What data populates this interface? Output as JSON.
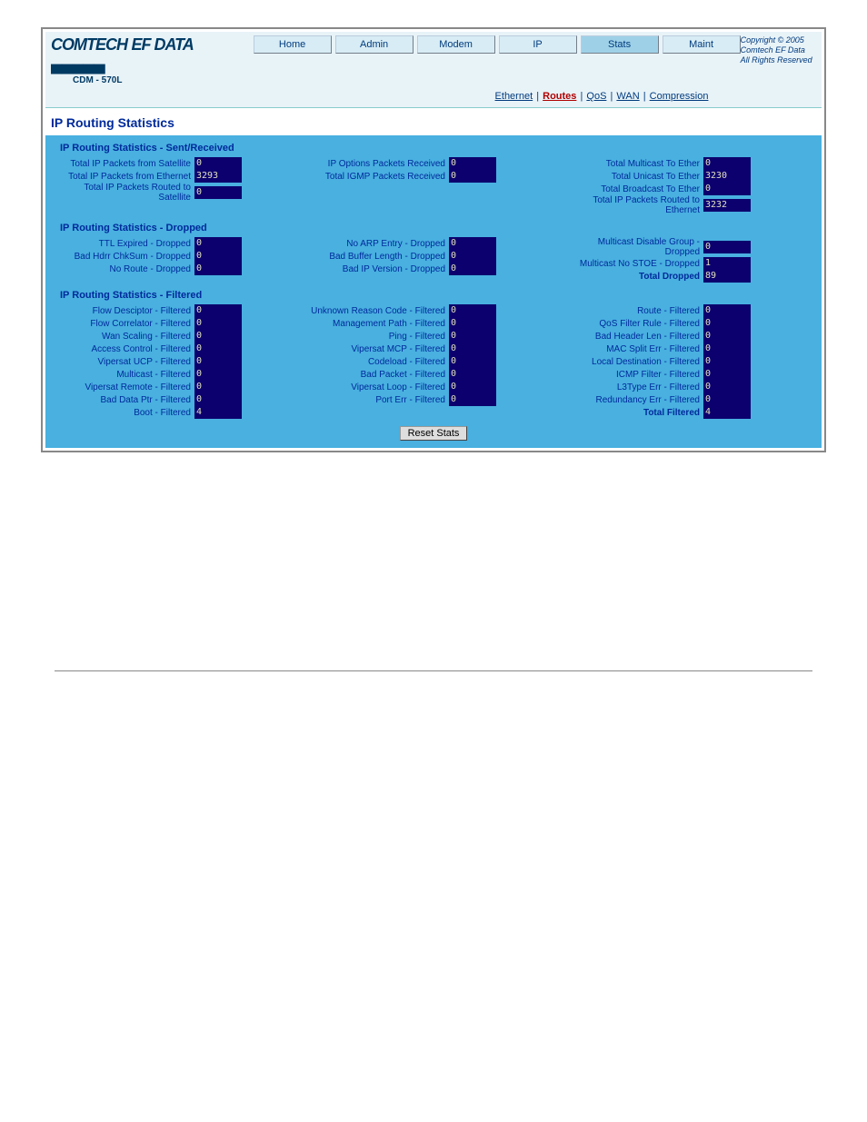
{
  "copyright": {
    "line1": "Copyright © 2005",
    "line2": "Comtech EF Data",
    "line3": "All Rights Reserved"
  },
  "logo": {
    "main": "COMTECH",
    "sub": "EF DATA ▄▄▄▄▄"
  },
  "model": "CDM - 570L",
  "tabs": [
    "Home",
    "Admin",
    "Modem",
    "IP",
    "Stats",
    "Maint"
  ],
  "active_tab": "Stats",
  "subnav": [
    "Ethernet",
    "Routes",
    "QoS",
    "WAN",
    "Compression"
  ],
  "subnav_current": "Routes",
  "page_title": "IP Routing Statistics",
  "sections": {
    "sent_received": {
      "heading": "IP Routing Statistics - Sent/Received",
      "col1": [
        {
          "label": "Total IP Packets from Satellite",
          "value": "0"
        },
        {
          "label": "Total IP Packets from Ethernet",
          "value": "3293"
        },
        {
          "label": "Total IP Packets Routed to Satellite",
          "value": "0"
        }
      ],
      "col2": [
        {
          "label": "IP Options Packets Received",
          "value": "0"
        },
        {
          "label": "Total IGMP Packets Received",
          "value": "0"
        }
      ],
      "col3": [
        {
          "label": "Total Multicast To Ether",
          "value": "0"
        },
        {
          "label": "Total Unicast To Ether",
          "value": "3230"
        },
        {
          "label": "Total Broadcast To Ether",
          "value": "0"
        },
        {
          "label": "Total IP Packets Routed to Ethernet",
          "value": "3232"
        }
      ]
    },
    "dropped": {
      "heading": "IP Routing Statistics - Dropped",
      "col1": [
        {
          "label": "TTL Expired - Dropped",
          "value": "0"
        },
        {
          "label": "Bad Hdrr ChkSum - Dropped",
          "value": "0"
        },
        {
          "label": "No Route - Dropped",
          "value": "0"
        }
      ],
      "col2": [
        {
          "label": "No ARP Entry - Dropped",
          "value": "0"
        },
        {
          "label": "Bad Buffer Length - Dropped",
          "value": "0"
        },
        {
          "label": "Bad IP Version - Dropped",
          "value": "0"
        }
      ],
      "col3": [
        {
          "label": "Multicast Disable Group - Dropped",
          "value": "0"
        },
        {
          "label": "Multicast No STOE - Dropped",
          "value": "1"
        },
        {
          "label": "Total Dropped",
          "value": "89",
          "bold": true
        }
      ]
    },
    "filtered": {
      "heading": "IP Routing Statistics - Filtered",
      "col1": [
        {
          "label": "Flow Desciptor - Filtered",
          "value": "0"
        },
        {
          "label": "Flow Correlator - Filtered",
          "value": "0"
        },
        {
          "label": "Wan Scaling - Filtered",
          "value": "0"
        },
        {
          "label": "Access Control - Filtered",
          "value": "0"
        },
        {
          "label": "Vipersat UCP - Filtered",
          "value": "0"
        },
        {
          "label": "Multicast - Filtered",
          "value": "0"
        },
        {
          "label": "Vipersat Remote - Filtered",
          "value": "0"
        },
        {
          "label": "Bad Data Ptr - Filtered",
          "value": "0"
        },
        {
          "label": "Boot - Filtered",
          "value": "4"
        }
      ],
      "col2": [
        {
          "label": "Unknown Reason Code - Filtered",
          "value": "0"
        },
        {
          "label": "Management Path - Filtered",
          "value": "0"
        },
        {
          "label": "Ping - Filtered",
          "value": "0"
        },
        {
          "label": "Vipersat MCP - Filtered",
          "value": "0"
        },
        {
          "label": "Codeload - Filtered",
          "value": "0"
        },
        {
          "label": "Bad Packet - Filtered",
          "value": "0"
        },
        {
          "label": "Vipersat Loop - Filtered",
          "value": "0"
        },
        {
          "label": "Port Err - Filtered",
          "value": "0"
        }
      ],
      "col3": [
        {
          "label": "Route - Filtered",
          "value": "0"
        },
        {
          "label": "QoS Filter Rule - Filtered",
          "value": "0"
        },
        {
          "label": "Bad Header Len - Filtered",
          "value": "0"
        },
        {
          "label": "MAC Split Err - Filtered",
          "value": "0"
        },
        {
          "label": "Local Destination - Filtered",
          "value": "0"
        },
        {
          "label": "ICMP Filter - Filtered",
          "value": "0"
        },
        {
          "label": "L3Type Err - Filtered",
          "value": "0"
        },
        {
          "label": "Redundancy Err - Filtered",
          "value": "0"
        },
        {
          "label": "Total Filtered",
          "value": "4",
          "bold": true
        }
      ]
    }
  },
  "reset_label": "Reset Stats"
}
